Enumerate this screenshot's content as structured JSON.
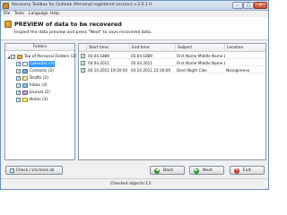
{
  "window": {
    "title": "Recovery Toolbox for Outlook (Personal registered version) v.3.0.1.0"
  },
  "menu": [
    "File",
    "Tools",
    "Language",
    "Help"
  ],
  "header": {
    "title": "PREVIEW of data to be recovered",
    "subtitle": "Inspect the data preview and press \"Next\" to save recovered data."
  },
  "folders": {
    "header": "Folders",
    "items": [
      {
        "label": "Top of Personal Folders (2)",
        "icon": "mailbox-icon",
        "level": 0,
        "checked": true,
        "expanded": true
      },
      {
        "label": "Calendar (3)",
        "icon": "calendar-icon",
        "level": 1,
        "checked": true,
        "selected": true
      },
      {
        "label": "Contacts (2)",
        "icon": "contacts-icon",
        "level": 1,
        "checked": true
      },
      {
        "label": "Drafts (2)",
        "icon": "drafts-icon",
        "level": 1,
        "checked": true
      },
      {
        "label": "Inbox (3)",
        "icon": "inbox-icon",
        "level": 1,
        "checked": true
      },
      {
        "label": "Journal (2)",
        "icon": "journal-icon",
        "level": 1,
        "checked": true
      },
      {
        "label": "Notes (3)",
        "icon": "notes-icon",
        "level": 1,
        "checked": true
      }
    ]
  },
  "messages": {
    "columns": [
      "Start time:",
      "End time:",
      "Subject",
      "Location"
    ],
    "rows": [
      {
        "start": "04.04.1889",
        "end": "05.04.1889",
        "subject": "First Name Middle Name L",
        "location": ""
      },
      {
        "start": "04.04.2011",
        "end": "05.04.2011",
        "subject": "First Name Middle Name L",
        "location": ""
      },
      {
        "start": "04.10.2011 19:30:00",
        "end": "04.10.2011 22:30:00",
        "subject": "Devil Night Clan",
        "location": "Novogireevo"
      }
    ]
  },
  "footer": {
    "check_all_label": "Check / Uncheck all",
    "back_label": "Back",
    "next_label": "Next",
    "exit_label": "Exit",
    "status": "Checked objects:13"
  },
  "colors": {
    "accent": "#3399ff",
    "check": "#1d8a1d",
    "back_icon": "#2f8f2f",
    "next_icon": "#2f8f2f",
    "exit_icon": "#c0392b"
  }
}
